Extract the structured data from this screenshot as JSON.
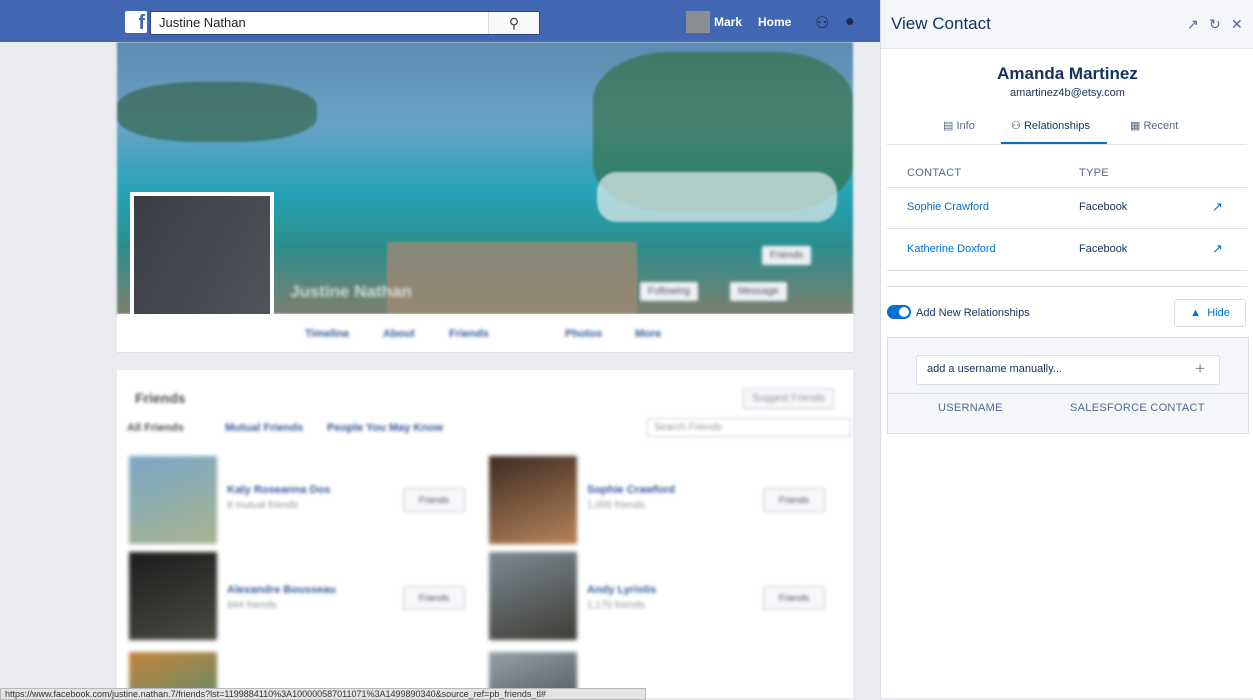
{
  "fb": {
    "search_value": "Justine Nathan",
    "user": "Mark",
    "home": "Home",
    "profile_name": "Justine Nathan",
    "tabs": [
      "Timeline",
      "About",
      "Friends",
      "Photos",
      "More"
    ],
    "friends_heading": "Friends",
    "friend_filters": [
      "All Friends",
      "Mutual Friends",
      "People You May Know"
    ],
    "suggest_btn": "Suggest Friends",
    "search_friends_placeholder": "Search Friends",
    "friend_btn": "Friends",
    "friends": [
      {
        "name": "Katy Roseanna Dos",
        "meta": "8 mutual friends"
      },
      {
        "name": "Sophie Crawford",
        "meta": "1,000 friends"
      },
      {
        "name": "Alexandre Bousseau",
        "meta": "844 friends"
      },
      {
        "name": "Andy Lyristis",
        "meta": "1,170 friends"
      }
    ],
    "status_url": "https://www.facebook.com/justine.nathan.7/friends?lst=1199884110%3A100000587011071%3A1499890340&source_ref=pb_friends_tl#"
  },
  "sf": {
    "title": "View Contact",
    "contact_name": "Amanda Martinez",
    "contact_email": "amartinez4b@etsy.com",
    "tabs": {
      "info": "Info",
      "relationships": "Relationships",
      "recent": "Recent"
    },
    "columns": {
      "contact": "CONTACT",
      "type": "TYPE"
    },
    "relationships": [
      {
        "name": "Sophie Crawford",
        "type": "Facebook"
      },
      {
        "name": "Katherine Doxford",
        "type": "Facebook"
      }
    ],
    "add_label": "Add New Relationships",
    "hide_label": "Hide",
    "input_placeholder": "add a username manually...",
    "table_cols": {
      "username": "USERNAME",
      "sf_contact": "SALESFORCE CONTACT"
    }
  }
}
